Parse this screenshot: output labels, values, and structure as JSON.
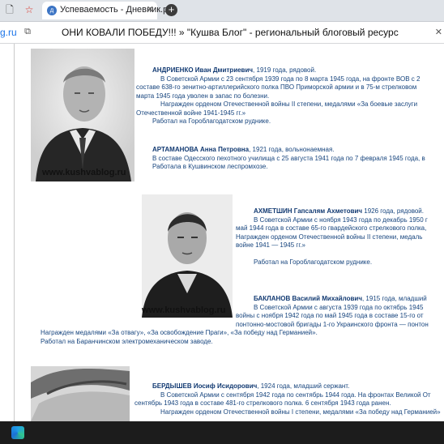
{
  "browser": {
    "tab": {
      "title": "Успеваемость - Дневник.ру",
      "close": "✕"
    },
    "new_tab": "+",
    "url_fragment": "g.ru",
    "page_title": "ОНИ КОВАЛИ ПОБЕДУ!!! » \"Кушва Блог\" - региональный блоговый ресурс"
  },
  "watermark": "www.kushvablog.ru",
  "entries": [
    {
      "name": "АНДРИЕНКО Иван Дмитриевич",
      "info": ", 1919 года, рядовой.",
      "lines": [
        "В Советской Армии с 23 сентября 1939 года по 8 марта 1945 года, на фронте ВОВ с 2",
        "составе 638-го зенитно-артиллерийского полка ПВО Приморской армии и в 75-м стрелковом",
        "марта 1945 года уволен в запас по болезни.",
        "Награжден орденом Отечественной войны II степени, медалями «За боевые заслуги",
        "Отечественной войне 1941-1945 гг.»",
        "Работал на Гороблагодатском руднике."
      ]
    },
    {
      "name": "АРТАМАНОВА Анна Петровна",
      "info": ", 1921 года, вольнонаемная.",
      "lines": [
        "В составе Одесского пехотного училища с 25 августа 1941 года по 7 февраля 1945 года, в",
        "Работала в Кушвинском леспромхозе."
      ]
    },
    {
      "name": "АХМЕТШИН Гапсалям Ахметович",
      "info": " 1926 года, рядовой.",
      "lines": [
        "В Советской Армии с ноября 1943 года по декабрь 1950 г",
        "май 1944 года в составе 65-го гвардейского стрелкового полка,",
        "Награжден орденом Отечественной войны II степени, медаль",
        "войне 1941 — 1945 гг.»",
        "Работал на Гороблагодатском руднике."
      ]
    },
    {
      "name": "БАКЛАНОВ Василий Михайлович",
      "info": ", 1915 года, младший",
      "lines": [
        "В Советской Армии с августа 1939 года по октябрь 1945",
        "войны с ноября 1942 года по май 1945 года в составе 15-го от",
        "понтонно-мостовой бригады 1-го Украинского фронта — понтон",
        "Награжден медалями «За отвагу», «За освобождение Праги», «За победу над Германией».",
        "Работал на Баранчинском электромеханическом заводе."
      ]
    },
    {
      "name": "БЕРДЫШЕВ Иосиф Исидорович",
      "info": ", 1924 года, младший сержант.",
      "lines": [
        "В Советской Армии с сентября 1942 года по сентябрь 1944 года. На фронтах Великой От",
        "сентябрь 1943 года в составе 481-го стрелкового полка. 6 сентября 1943 года ранен.",
        "Награжден орденом Отечественной войны I степени, медалями «За победу над Германией»"
      ]
    }
  ]
}
